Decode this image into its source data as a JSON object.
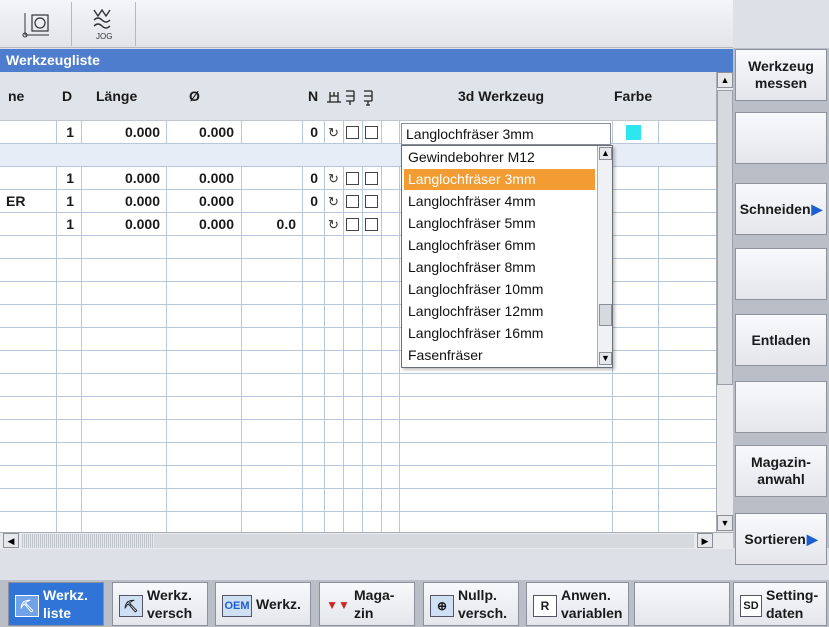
{
  "top_icons": [
    {
      "name": "axis-icon"
    },
    {
      "name": "jog-icon",
      "label": "JOG"
    }
  ],
  "title": "Werkzeugliste",
  "columns": {
    "name": "ne",
    "d": "D",
    "laenge": "Länge",
    "durchmesser": "Ø",
    "n": "N",
    "werkzeug3d": "3d Werkzeug",
    "farbe": "Farbe"
  },
  "rows": [
    {
      "name": "",
      "d": "1",
      "laenge": "0.000",
      "durchmesser": "0.000",
      "extra": "",
      "n": "0",
      "farbe": "#2ee6f0"
    },
    {
      "name": "",
      "d": "",
      "laenge": "",
      "durchmesser": "",
      "extra": "",
      "n": ""
    },
    {
      "name": "",
      "d": "1",
      "laenge": "0.000",
      "durchmesser": "0.000",
      "extra": "",
      "n": "0"
    },
    {
      "name": "ER",
      "d": "1",
      "laenge": "0.000",
      "durchmesser": "0.000",
      "extra": "",
      "n": "0"
    },
    {
      "name": "",
      "d": "1",
      "laenge": "0.000",
      "durchmesser": "0.000",
      "extra": "0.0",
      "n": ""
    }
  ],
  "combo_value": "Langlochfräser 3mm",
  "dropdown_options": [
    "Gewindebohrer M12",
    "Langlochfräser 3mm",
    "Langlochfräser 4mm",
    "Langlochfräser 5mm",
    "Langlochfräser 6mm",
    "Langlochfräser 8mm",
    "Langlochfräser 10mm",
    "Langlochfräser 12mm",
    "Langlochfräser 16mm",
    "Fasenfräser"
  ],
  "selected_option": "Langlochfräser 3mm",
  "softkeys": [
    "Werkzeug messen",
    "",
    "Schneiden",
    "",
    "Entladen",
    "",
    "Magazin-anwahl",
    "Sortieren"
  ],
  "bottom_keys": [
    {
      "label": "Werkz.\nliste",
      "icon": "tool-list-icon",
      "active": true
    },
    {
      "label": "Werkz.\nversch",
      "icon": "tool-wear-icon"
    },
    {
      "label": "Werkz.",
      "icon": "oem-icon",
      "icon_text": "OEM"
    },
    {
      "label": "Maga-\nzin",
      "icon": "magazine-icon"
    },
    {
      "label": "Nullp.\nversch.",
      "icon": "zero-offset-icon"
    },
    {
      "label": "Anwen.\nvariablen",
      "icon": "user-variable-icon",
      "icon_text": "R"
    },
    {
      "label": "",
      "icon": ""
    },
    {
      "label": "Setting-\ndaten",
      "icon": "setting-data-icon",
      "icon_text": "SD"
    }
  ],
  "colors": {
    "title_bar": "#4d7dcc",
    "selection": "#f39c33",
    "active_key": "#2f74d6"
  }
}
